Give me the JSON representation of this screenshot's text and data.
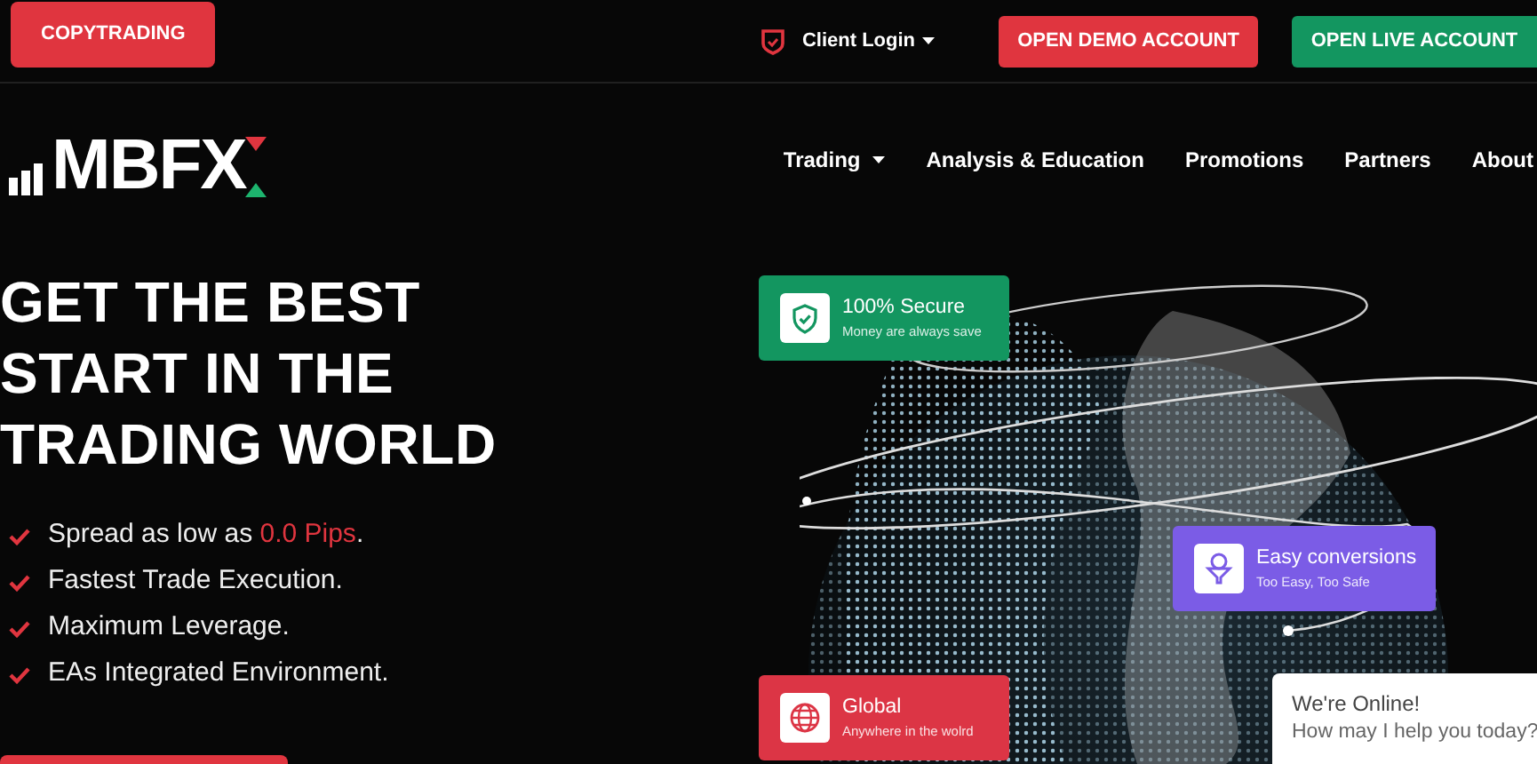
{
  "top_bar": {
    "copytrading": "COPYTRADING",
    "client_login": "Client Login",
    "demo_button": "OPEN DEMO ACCOUNT",
    "live_button": "OPEN LIVE ACCOUNT"
  },
  "logo": {
    "text": "MBFX"
  },
  "nav": [
    {
      "label": "Trading",
      "has_menu": true
    },
    {
      "label": "Analysis & Education",
      "has_menu": false
    },
    {
      "label": "Promotions",
      "has_menu": false
    },
    {
      "label": "Partners",
      "has_menu": false
    },
    {
      "label": "About",
      "has_menu": false
    }
  ],
  "hero": {
    "heading": [
      "GET THE BEST",
      "START IN THE",
      "TRADING WORLD"
    ],
    "features": [
      {
        "parts": [
          {
            "text": "Spread as low as ",
            "highlight": false
          },
          {
            "text": "0.0 Pips",
            "highlight": true
          },
          {
            "text": ".",
            "highlight": false
          }
        ]
      },
      {
        "parts": [
          {
            "text": "Fastest Trade Execution.",
            "highlight": false
          }
        ]
      },
      {
        "parts": [
          {
            "text": "Maximum Leverage.",
            "highlight": false
          }
        ]
      },
      {
        "parts": [
          {
            "text": "EAs Integrated Environment.",
            "highlight": false
          }
        ]
      }
    ]
  },
  "cards": [
    {
      "kind": "shield",
      "title": "100% Secure",
      "subtitle": "Money are always save",
      "color": "#139660"
    },
    {
      "kind": "funnel",
      "title": "Easy conversions",
      "subtitle": "Too Easy, Too Safe",
      "color": "#7b5ce6"
    },
    {
      "kind": "globe",
      "title": "Global",
      "subtitle": "Anywhere in the wolrd",
      "color": "#dc3545"
    }
  ],
  "chat": {
    "title": "We're Online!",
    "subtitle": "How may I help you today?"
  }
}
